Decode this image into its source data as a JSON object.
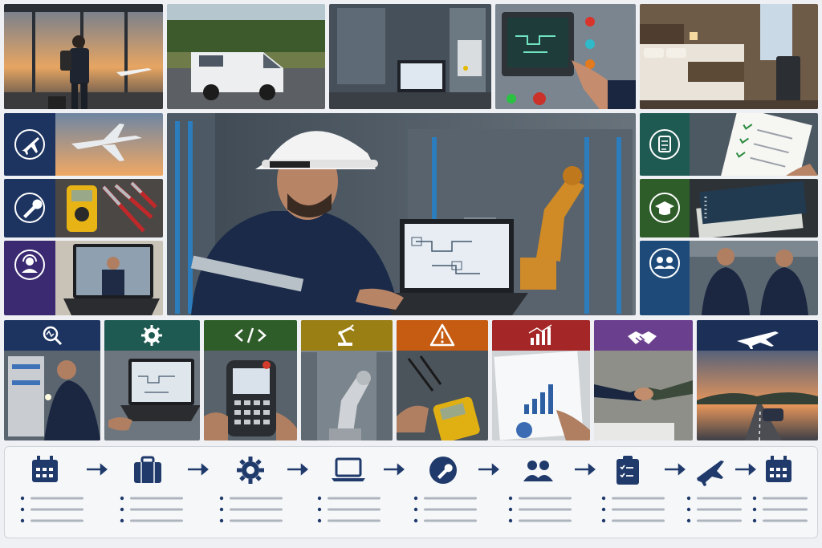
{
  "colors": {
    "navy": "#1d3461",
    "purple": "#3b2a72",
    "teal": "#1f5a52",
    "green": "#2f5d2a",
    "blue": "#1e4a7a",
    "olive": "#9a7f14",
    "orange": "#c65c12",
    "red": "#a52626",
    "violet": "#6a3f8e",
    "darknavy": "#1b2f57"
  },
  "top_row": [
    "airport-traveler",
    "service-van",
    "lab-laptop-equipment",
    "control-panel-touch",
    "hotel-room"
  ],
  "left_tiles": [
    {
      "icon": "airplane-icon",
      "photo": "airplane-sunset"
    },
    {
      "icon": "wrench-icon",
      "photo": "multimeter-tools"
    },
    {
      "icon": "headset-user-icon",
      "photo": "video-call-laptop"
    }
  ],
  "right_tiles": [
    {
      "icon": "checklist-icon",
      "photo": "clipboard-checklist"
    },
    {
      "icon": "graduation-cap-icon",
      "photo": "training-notebooks"
    },
    {
      "icon": "team-icon",
      "photo": "engineers-discussion"
    }
  ],
  "hero": "engineer-with-laptop-factory",
  "bottom_tiles": [
    {
      "icon": "diagnostic-search-icon",
      "photo": "electrical-cabinet-flashlight"
    },
    {
      "icon": "gear-icon",
      "photo": "laptop-configuration"
    },
    {
      "icon": "code-icon",
      "photo": "teach-pendant"
    },
    {
      "icon": "robot-arm-icon",
      "photo": "industrial-robot"
    },
    {
      "icon": "warning-icon",
      "photo": "multimeter-measure"
    },
    {
      "icon": "bar-chart-icon",
      "photo": "report-chart"
    },
    {
      "icon": "handshake-icon",
      "photo": "handshake"
    },
    {
      "icon": "airplane-icon",
      "photo": "highway-sunset"
    }
  ],
  "timeline": [
    "calendar-icon",
    "briefcase-icon",
    "gear-icon",
    "laptop-icon",
    "wrench-icon",
    "team-icon",
    "clipboard-icon",
    "airplane-icon",
    "calendar-icon"
  ]
}
